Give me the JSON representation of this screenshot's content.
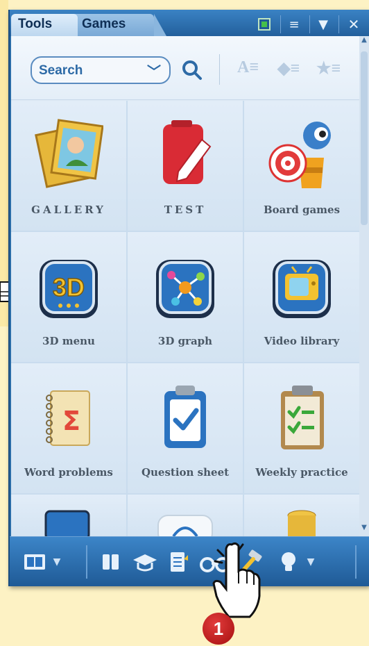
{
  "tabs": [
    {
      "label": "Tools",
      "active": true
    },
    {
      "label": "Games",
      "active": false
    }
  ],
  "titlebar_icons": [
    "window-green-icon",
    "menu-lines-icon",
    "dropdown-triangle-icon",
    "close-icon"
  ],
  "search": {
    "value": "Search",
    "icon": "magnifier-icon"
  },
  "toolbar_glyphs": [
    "A≡",
    "◆≡",
    "★≡"
  ],
  "grid_items": [
    {
      "label": "GALLERY",
      "icon": "picture-frame-icon"
    },
    {
      "label": "TEST",
      "icon": "test-pencil-icon"
    },
    {
      "label": "Board games",
      "icon": "dartboard-figure-icon"
    },
    {
      "label": "3D menu",
      "icon": "3d-menu-icon"
    },
    {
      "label": "3D graph",
      "icon": "3d-graph-icon"
    },
    {
      "label": "Video library",
      "icon": "tv-icon"
    },
    {
      "label": "Word problems",
      "icon": "notebook-sigma-icon"
    },
    {
      "label": "Question sheet",
      "icon": "clipboard-check-icon"
    },
    {
      "label": "Weekly practice",
      "icon": "checklist-clipboard-icon"
    }
  ],
  "bottom_toolbar": [
    "book-icon",
    "columns-icon",
    "graduation-cap-icon",
    "notes-icon",
    "binoculars-icon",
    "hammer-icon",
    "lightbulb-icon"
  ],
  "callout_number": "1",
  "colors": {
    "accent": "#2a6ca8",
    "panel_bg": "#dde9f4",
    "page_bg": "#fdf2c4",
    "badge": "#c41e1e"
  }
}
